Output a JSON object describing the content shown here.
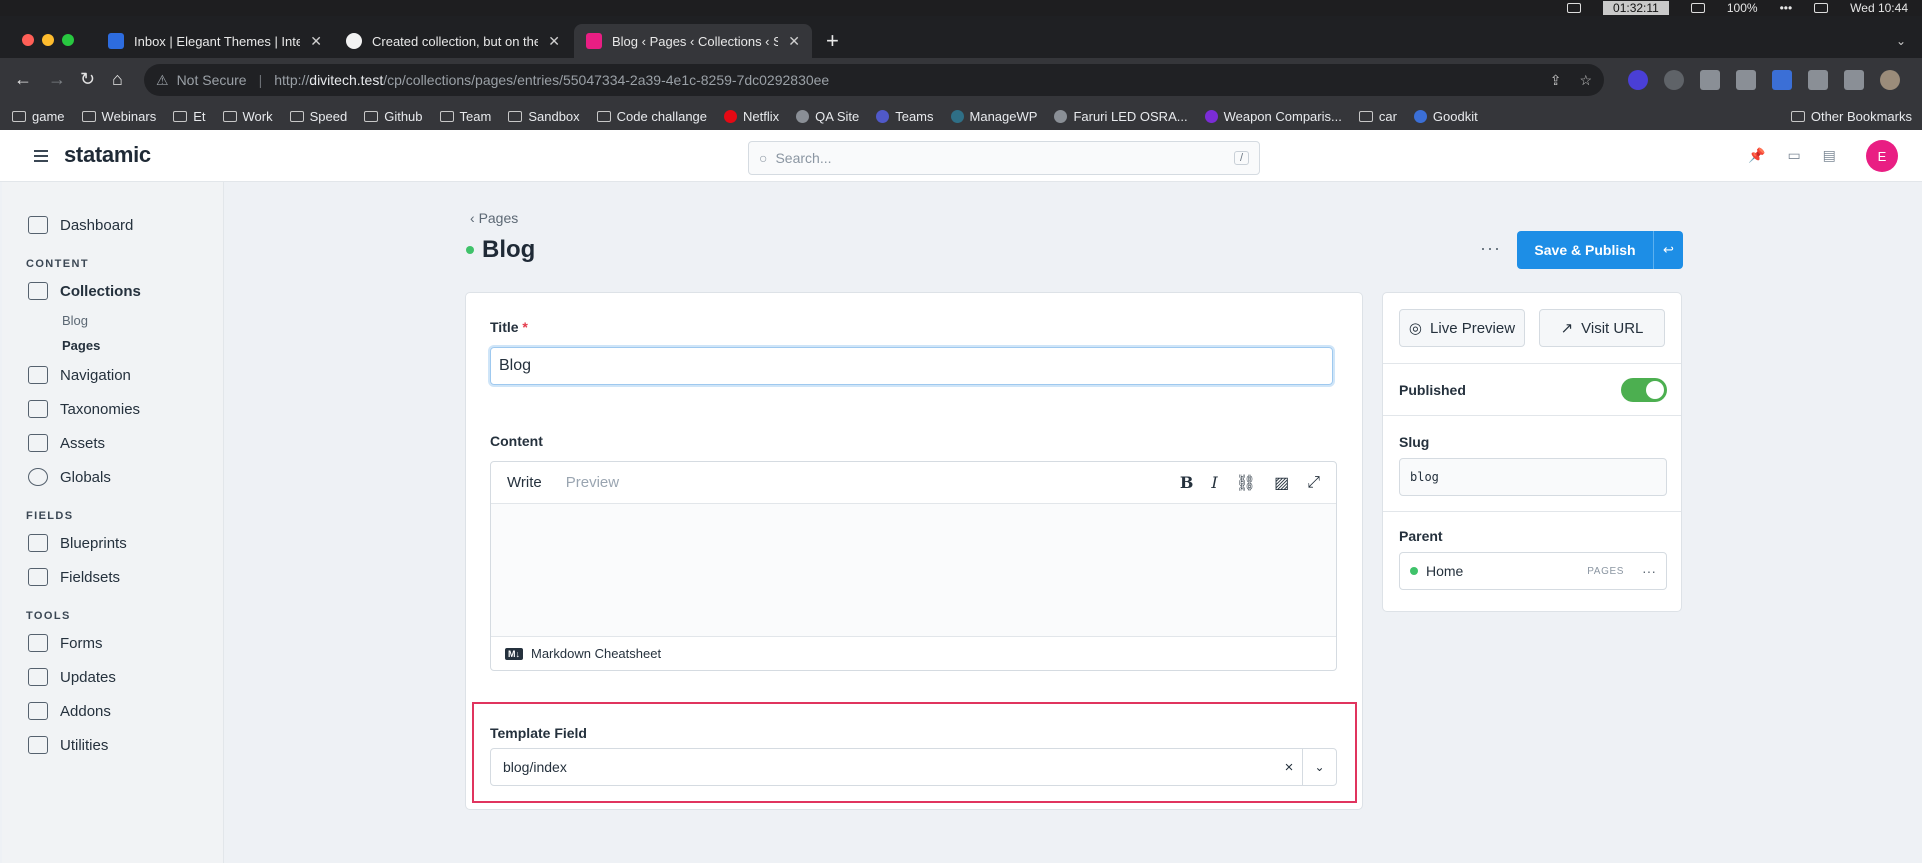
{
  "menubar": {
    "timer": "01:32:11",
    "battery": "100%",
    "clock": "Wed  10:44"
  },
  "browser": {
    "tabs": [
      {
        "title": "Inbox | Elegant Themes | Interc",
        "favicon_color": "#2d6cdf"
      },
      {
        "title": "Created collection, but on the",
        "favicon_color": "#f2f2f2"
      },
      {
        "title": "Blog ‹ Pages ‹ Collections ‹ St",
        "favicon_color": "#e91e83"
      }
    ],
    "url": {
      "warning": "Not Secure",
      "prefix": "http://",
      "host": "divitech.test",
      "path": "/cp/collections/pages/entries/55047334-2a39-4e1c-8259-7dc0292830ee"
    },
    "bookmarks": [
      "game",
      "Webinars",
      "Et",
      "Work",
      "Speed",
      "Github",
      "Team",
      "Sandbox",
      "Code challange",
      "Netflix",
      "QA Site",
      "Teams",
      "ManageWP",
      "Faruri LED OSRA...",
      "Weapon Comparis...",
      "car",
      "Goodkit"
    ],
    "other_bookmarks": "Other Bookmarks"
  },
  "app": {
    "logo": "statamic",
    "search_placeholder": "Search...",
    "search_kbd": "/",
    "avatar_initial": "E",
    "sidebar": {
      "top": [
        {
          "label": "Dashboard"
        }
      ],
      "content_heading": "CONTENT",
      "content": [
        {
          "label": "Collections",
          "children": [
            "Blog",
            "Pages"
          ]
        },
        {
          "label": "Navigation"
        },
        {
          "label": "Taxonomies"
        },
        {
          "label": "Assets"
        },
        {
          "label": "Globals"
        }
      ],
      "fields_heading": "FIELDS",
      "fields": [
        {
          "label": "Blueprints"
        },
        {
          "label": "Fieldsets"
        }
      ],
      "tools_heading": "TOOLS",
      "tools": [
        {
          "label": "Forms"
        },
        {
          "label": "Updates"
        },
        {
          "label": "Addons"
        },
        {
          "label": "Utilities"
        }
      ]
    },
    "breadcrumb": "Pages",
    "page_title": "Blog",
    "publish_label": "Save & Publish",
    "form": {
      "title_label": "Title",
      "title_required": "*",
      "title_value": "Blog",
      "content_label": "Content",
      "editor_tabs": {
        "write": "Write",
        "preview": "Preview"
      },
      "md_badge": "M↓",
      "md_cheatsheet": "Markdown Cheatsheet",
      "template_label": "Template Field",
      "template_value": "blog/index"
    },
    "sidebar_panel": {
      "live_preview": "Live Preview",
      "visit_url": "Visit URL",
      "published_label": "Published",
      "published": true,
      "slug_label": "Slug",
      "slug_value": "blog",
      "parent_label": "Parent",
      "parent_value": "Home",
      "parent_tag": "PAGES"
    }
  },
  "colors": {
    "accent": "#1d8ee6",
    "highlight_border": "#e0345e",
    "status_green": "#3fc26a",
    "avatar": "#e91e83"
  }
}
